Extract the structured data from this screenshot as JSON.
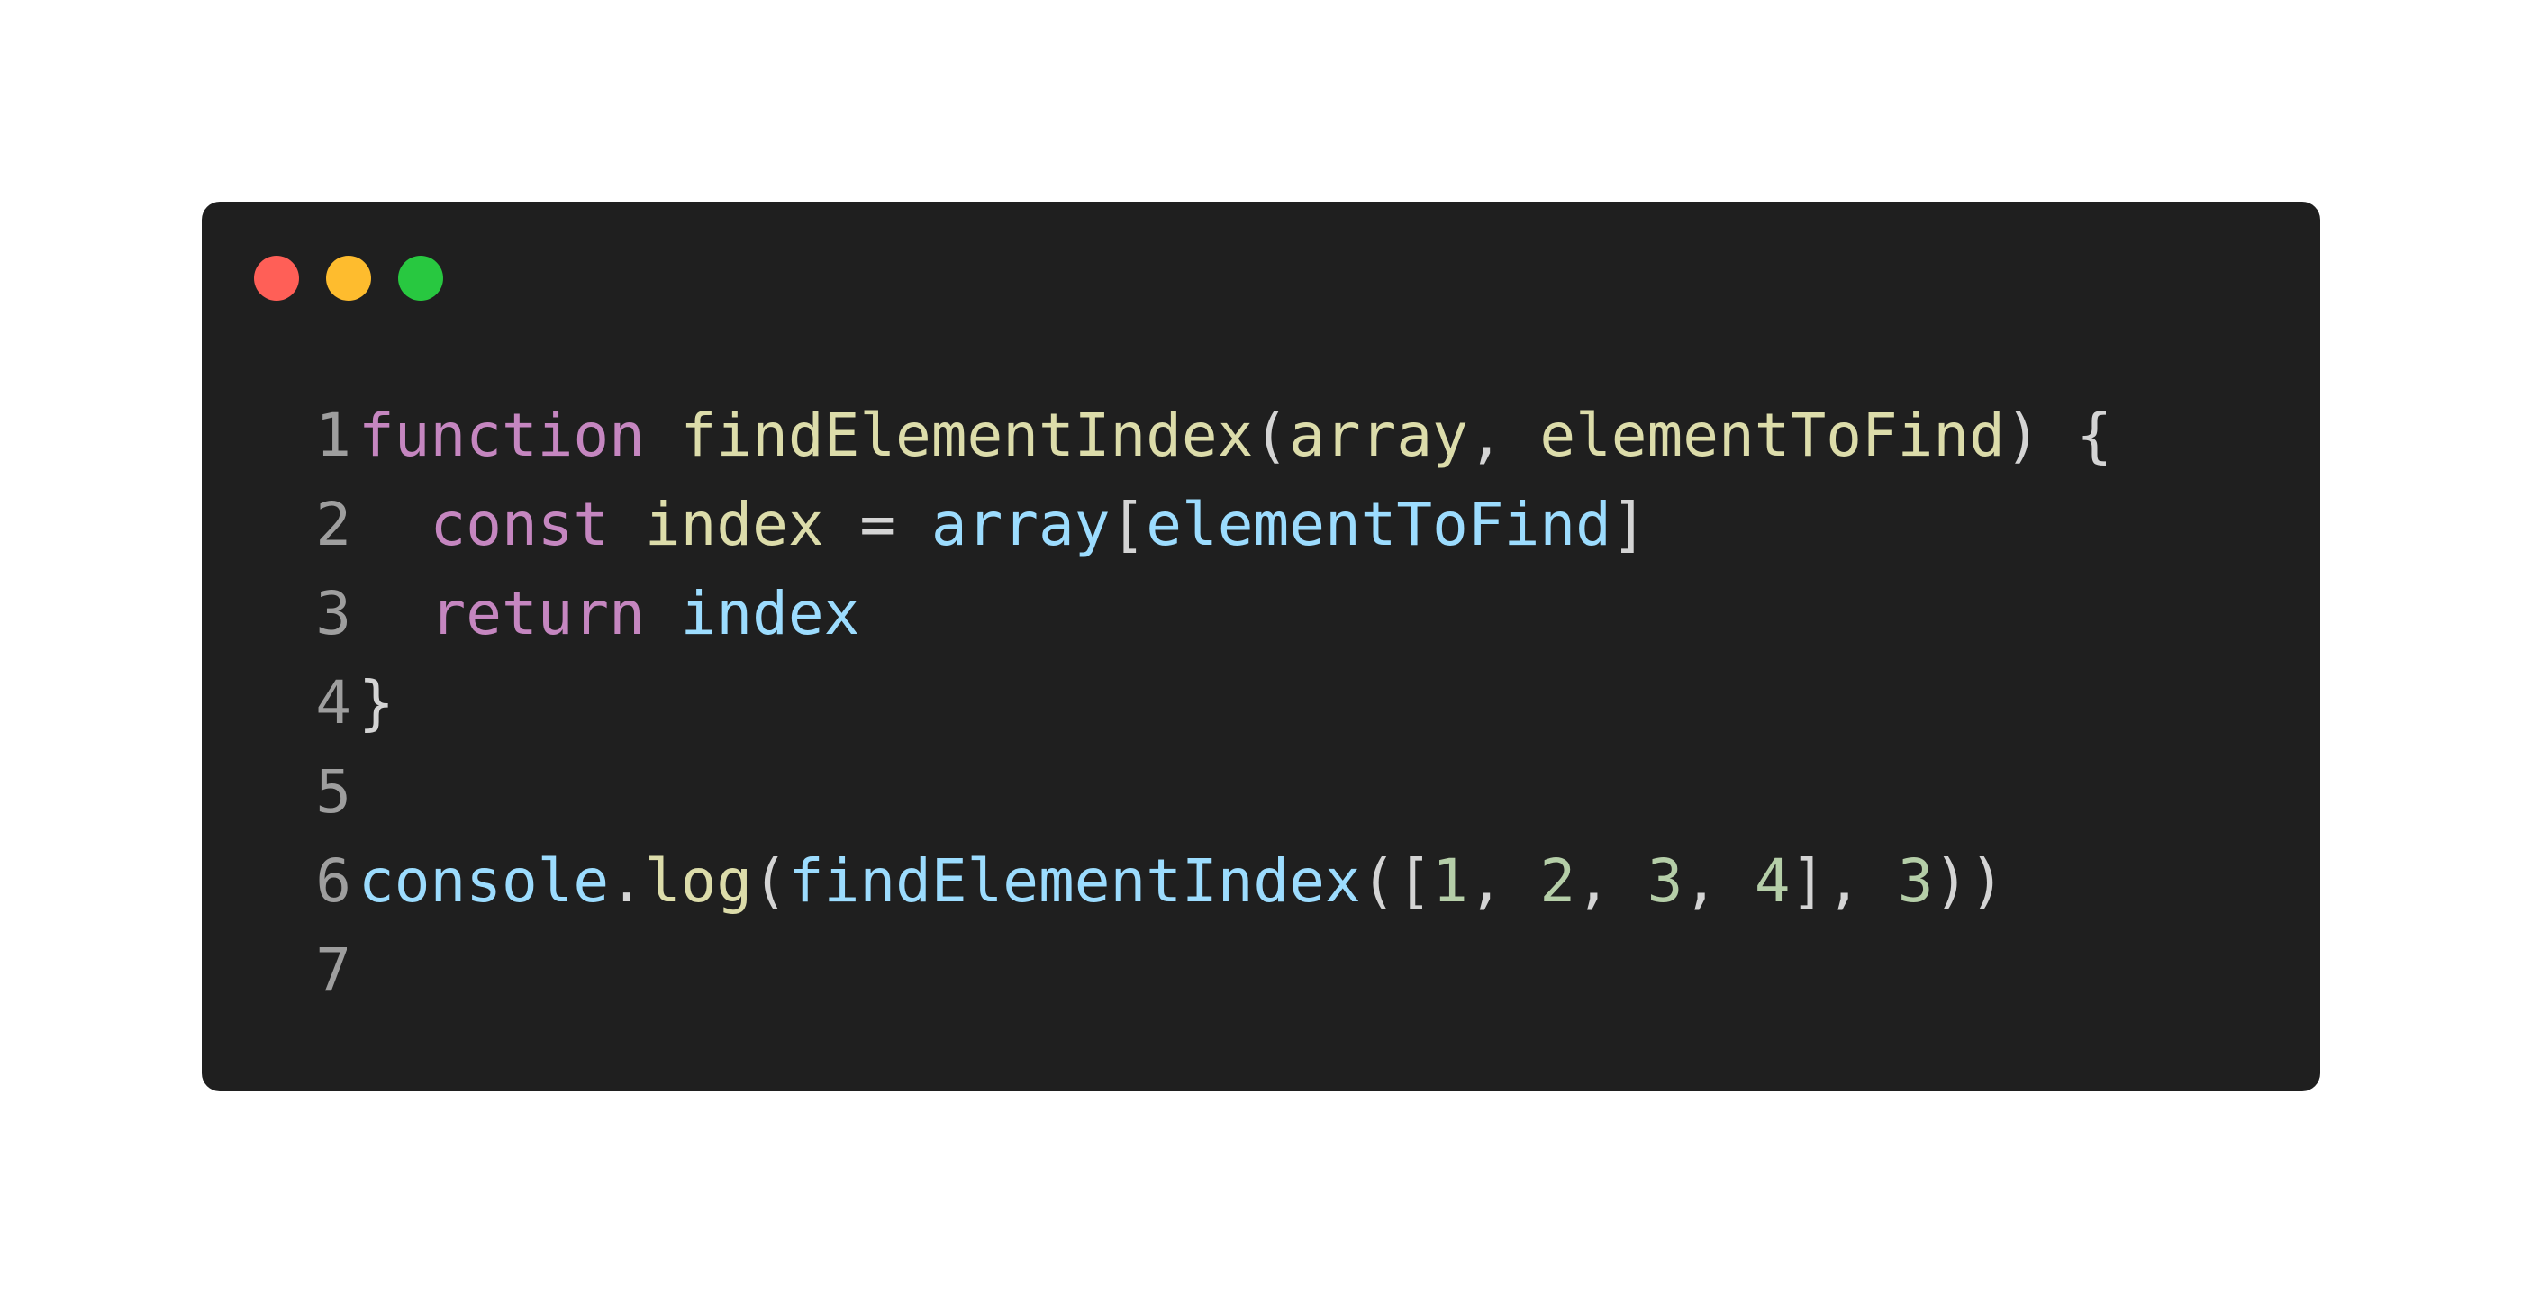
{
  "window": {
    "colors": {
      "background": "#1f1f1f",
      "close": "#ff5f57",
      "minimize": "#febc2e",
      "maximize": "#28c840"
    }
  },
  "editor": {
    "lines": [
      {
        "number": "1",
        "tokens": [
          {
            "text": "function",
            "kind": "keyword"
          },
          {
            "text": " ",
            "kind": "plain"
          },
          {
            "text": "findElementIndex",
            "kind": "fn"
          },
          {
            "text": "(",
            "kind": "punc"
          },
          {
            "text": "array",
            "kind": "param"
          },
          {
            "text": ", ",
            "kind": "punc"
          },
          {
            "text": "elementToFind",
            "kind": "param"
          },
          {
            "text": ") {",
            "kind": "punc"
          }
        ]
      },
      {
        "number": "2",
        "tokens": [
          {
            "text": "  ",
            "kind": "plain"
          },
          {
            "text": "const",
            "kind": "keyword"
          },
          {
            "text": " ",
            "kind": "plain"
          },
          {
            "text": "index",
            "kind": "fn"
          },
          {
            "text": " = ",
            "kind": "punc"
          },
          {
            "text": "array",
            "kind": "var"
          },
          {
            "text": "[",
            "kind": "punc"
          },
          {
            "text": "elementToFind",
            "kind": "var"
          },
          {
            "text": "]",
            "kind": "punc"
          }
        ]
      },
      {
        "number": "3",
        "tokens": [
          {
            "text": "  ",
            "kind": "plain"
          },
          {
            "text": "return",
            "kind": "keyword"
          },
          {
            "text": " ",
            "kind": "plain"
          },
          {
            "text": "index",
            "kind": "var"
          }
        ]
      },
      {
        "number": "4",
        "tokens": [
          {
            "text": "}",
            "kind": "punc"
          }
        ]
      },
      {
        "number": "5",
        "tokens": []
      },
      {
        "number": "6",
        "tokens": [
          {
            "text": "console",
            "kind": "var"
          },
          {
            "text": ".",
            "kind": "punc"
          },
          {
            "text": "log",
            "kind": "fn"
          },
          {
            "text": "(",
            "kind": "punc"
          },
          {
            "text": "findElementIndex",
            "kind": "var"
          },
          {
            "text": "([",
            "kind": "punc"
          },
          {
            "text": "1",
            "kind": "num"
          },
          {
            "text": ", ",
            "kind": "punc"
          },
          {
            "text": "2",
            "kind": "num"
          },
          {
            "text": ", ",
            "kind": "punc"
          },
          {
            "text": "3",
            "kind": "num"
          },
          {
            "text": ", ",
            "kind": "punc"
          },
          {
            "text": "4",
            "kind": "num"
          },
          {
            "text": "], ",
            "kind": "punc"
          },
          {
            "text": "3",
            "kind": "num"
          },
          {
            "text": "))",
            "kind": "punc"
          }
        ]
      },
      {
        "number": "7",
        "tokens": []
      }
    ]
  }
}
